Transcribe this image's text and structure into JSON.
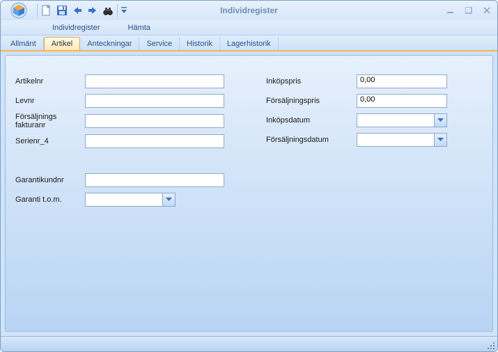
{
  "window": {
    "title": "Individregister"
  },
  "menu": {
    "item1": "Individregister",
    "item2": "Hämta"
  },
  "tabs": {
    "t0": "Allmänt",
    "t1": "Artikel",
    "t2": "Anteckningar",
    "t3": "Service",
    "t4": "Historik",
    "t5": "Lagerhistorik"
  },
  "labels": {
    "artikelnr": "Artikelnr",
    "levnr": "Levnr",
    "forsaljningsfakturanr": "Försäljnings fakturanr",
    "serienr4": "Serienr_4",
    "garantikundnr": "Garantikundnr",
    "garantitom": "Garanti t.o.m.",
    "inkopspris": "Inköpspris",
    "forsaljningspris": "Försäljningspris",
    "inkopsdatum": "Inköpsdatum",
    "forsaljningsdatum": "Försäljningsdatum"
  },
  "values": {
    "artikelnr": "",
    "levnr": "",
    "forsaljningsfakturanr": "",
    "serienr4": "",
    "garantikundnr": "",
    "garantitom": "",
    "inkopspris": "0,00",
    "forsaljningspris": "0,00",
    "inkopsdatum": "",
    "forsaljningsdatum": ""
  }
}
